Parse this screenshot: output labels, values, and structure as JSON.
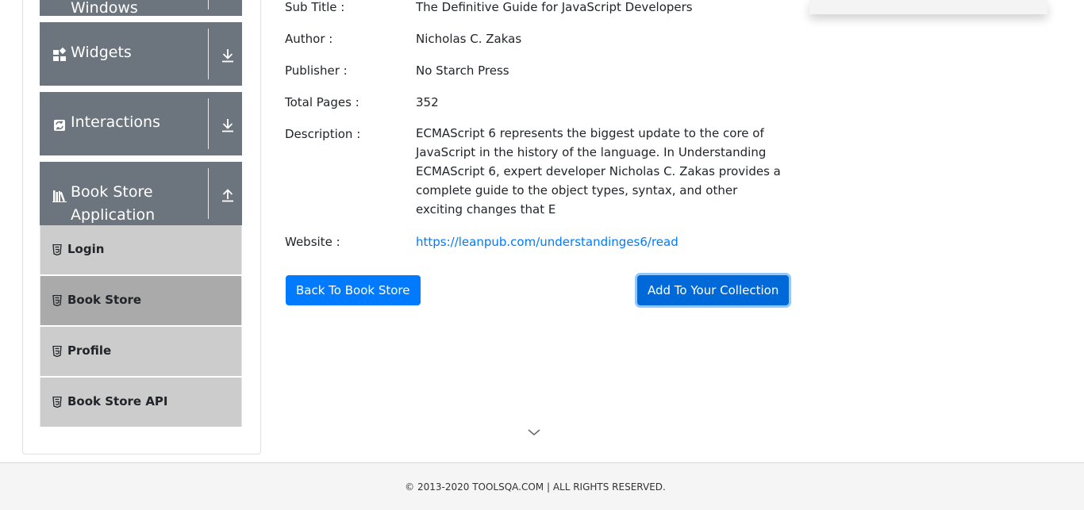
{
  "sidebar": {
    "groups": [
      {
        "label": "Windows",
        "icon": "windows-icon",
        "arrow": "download-arrow-icon"
      },
      {
        "label": "Widgets",
        "icon": "widgets-icon",
        "arrow": "download-arrow-icon"
      },
      {
        "label": "Interactions",
        "icon": "interactions-icon",
        "arrow": "download-arrow-icon"
      },
      {
        "label_line1": "Book Store",
        "label_line2": "Application",
        "icon": "books-icon",
        "arrow": "upload-arrow-icon",
        "expanded": true
      }
    ],
    "items": [
      {
        "label": "Login",
        "icon": "html5-icon",
        "active": false
      },
      {
        "label": "Book Store",
        "icon": "html5-icon",
        "active": true
      },
      {
        "label": "Profile",
        "icon": "html5-icon",
        "active": false
      },
      {
        "label": "Book Store API",
        "icon": "html5-icon",
        "active": false
      }
    ]
  },
  "book": {
    "subtitle_label": "Sub Title :",
    "subtitle": "The Definitive Guide for JavaScript Developers",
    "author_label": "Author :",
    "author": "Nicholas C. Zakas",
    "publisher_label": "Publisher :",
    "publisher": "No Starch Press",
    "pages_label": "Total Pages :",
    "pages": "352",
    "description_label": "Description :",
    "description": "ECMAScript 6 represents the biggest update to the core of JavaScript in the history of the language. In Understanding ECMAScript 6, expert developer Nicholas C. Zakas provides a complete guide to the object types, syntax, and other exciting changes that E",
    "website_label": "Website :",
    "website": "https://leanpub.com/understandinges6/read"
  },
  "actions": {
    "back_label": "Back To Book Store",
    "add_label": "Add To Your Collection"
  },
  "footer": {
    "text": "© 2013-2020 TOOLSQA.COM | ALL RIGHTS RESERVED."
  },
  "colors": {
    "group_header_bg": "#6c757d",
    "menu_item_bg": "#cccccc",
    "menu_item_active_bg": "#aaaaaa",
    "primary": "#007bff",
    "link": "#007bff"
  }
}
